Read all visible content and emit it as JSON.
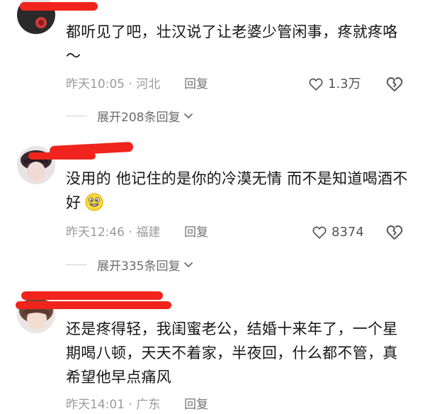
{
  "comments": [
    {
      "text": "都听见了吧，壮汉说了让老婆少管闲事，疼就疼咯～",
      "time_location": "昨天10:05 · 河北",
      "reply_label": "回复",
      "likes": "1.3万",
      "expand_label": "展开208条回复"
    },
    {
      "text": "没用的 他记住的是你的冷漠无情 而不是知道喝酒不好",
      "time_location": "昨天12:46 · 福建",
      "reply_label": "回复",
      "likes": "8374",
      "expand_label": "展开335条回复"
    },
    {
      "text": "还是疼得轻，我闺蜜老公，结婚十来年了，一个星期喝八顿，天天不着家，半夜回，什么都不管，真希望他早点痛风",
      "time_location": "昨天14:01 · 广东",
      "reply_label": "回复",
      "likes": ""
    }
  ],
  "icons": {
    "like": "heart-outline-icon",
    "dislike": "broken-heart-icon",
    "expand": "chevron-down-icon",
    "emoji": "grinning-face-emoji"
  },
  "colors": {
    "redaction": "#f0241c",
    "text": "#161616",
    "meta": "#9a9a9a"
  }
}
